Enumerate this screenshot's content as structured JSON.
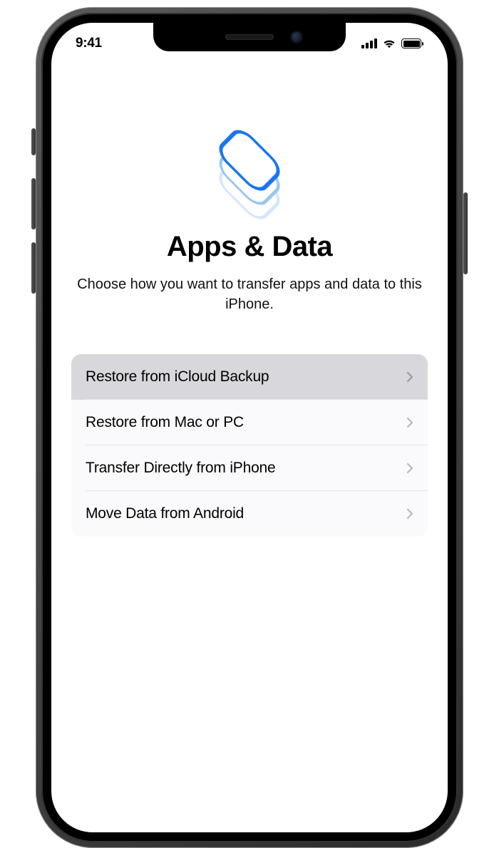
{
  "statusbar": {
    "time": "9:41"
  },
  "page": {
    "title": "Apps & Data",
    "subtitle": "Choose how you want to transfer apps and data to this iPhone."
  },
  "options": [
    {
      "label": "Restore from iCloud Backup",
      "selected": true
    },
    {
      "label": "Restore from Mac or PC",
      "selected": false
    },
    {
      "label": "Transfer Directly from iPhone",
      "selected": false
    },
    {
      "label": "Move Data from Android",
      "selected": false
    }
  ]
}
